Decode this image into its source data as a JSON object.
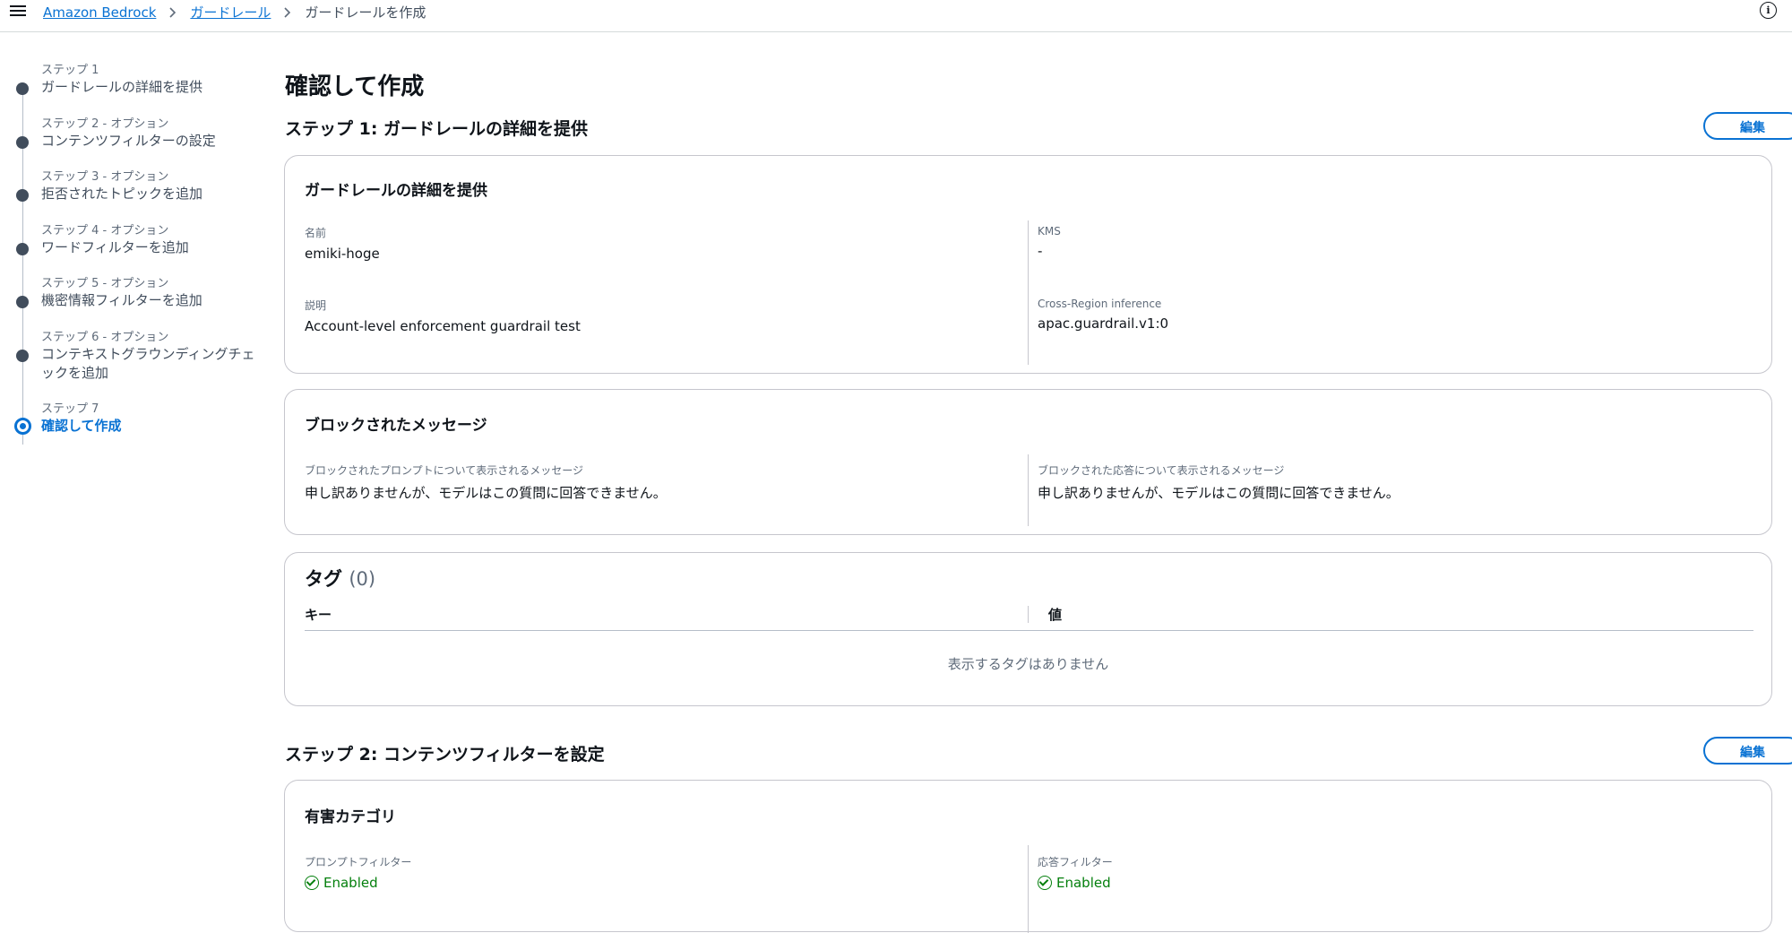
{
  "breadcrumb": {
    "items": [
      "Amazon Bedrock",
      "ガードレール"
    ],
    "current": "ガードレールを作成"
  },
  "icons": {
    "menu": "hamburger-icon",
    "info": "info-icon",
    "separator": "chevron-right-icon",
    "status": "check-circle-icon"
  },
  "colors": {
    "link": "#0972d3",
    "success": "#037f0c",
    "text": "#0f141a"
  },
  "nav": {
    "steps": [
      {
        "caption": "ステップ 1",
        "label": "ガードレールの詳細を提供"
      },
      {
        "caption": "ステップ 2 - オプション",
        "label": "コンテンツフィルターの設定"
      },
      {
        "caption": "ステップ 3 - オプション",
        "label": "拒否されたトピックを追加"
      },
      {
        "caption": "ステップ 4 - オプション",
        "label": "ワードフィルターを追加"
      },
      {
        "caption": "ステップ 5 - オプション",
        "label": "機密情報フィルターを追加"
      },
      {
        "caption": "ステップ 6 - オプション",
        "label": "コンテキストグラウンディングチェックを追加"
      },
      {
        "caption": "ステップ 7",
        "label": "確認して作成"
      }
    ]
  },
  "main": {
    "title": "確認して作成",
    "step1": {
      "title": "ステップ 1: ガードレールの詳細を提供",
      "edit": "編集",
      "details": {
        "heading": "ガードレールの詳細を提供",
        "name_label": "名前",
        "name_value": "emiki-hoge",
        "desc_label": "説明",
        "desc_value": "Account-level enforcement guardrail test",
        "kms_label": "KMS",
        "kms_value": "-",
        "xregion_label": "Cross-Region inference",
        "xregion_value": "apac.guardrail.v1:0"
      },
      "blocked": {
        "heading": "ブロックされたメッセージ",
        "prompt_label": "ブロックされたプロンプトについて表示されるメッセージ",
        "prompt_value": "申し訳ありませんが、モデルはこの質問に回答できません。",
        "response_label": "ブロックされた応答について表示されるメッセージ",
        "response_value": "申し訳ありませんが、モデルはこの質問に回答できません。"
      },
      "tags": {
        "heading": "タグ",
        "count": "(0)",
        "col_key": "キー",
        "col_value": "値",
        "empty": "表示するタグはありません"
      }
    },
    "step2": {
      "title": "ステップ 2: コンテンツフィルターを設定",
      "edit": "編集",
      "harmful": {
        "heading": "有害カテゴリ",
        "prompt_label": "プロンプトフィルター",
        "prompt_status": "Enabled",
        "response_label": "応答フィルター",
        "response_status": "Enabled"
      }
    }
  }
}
